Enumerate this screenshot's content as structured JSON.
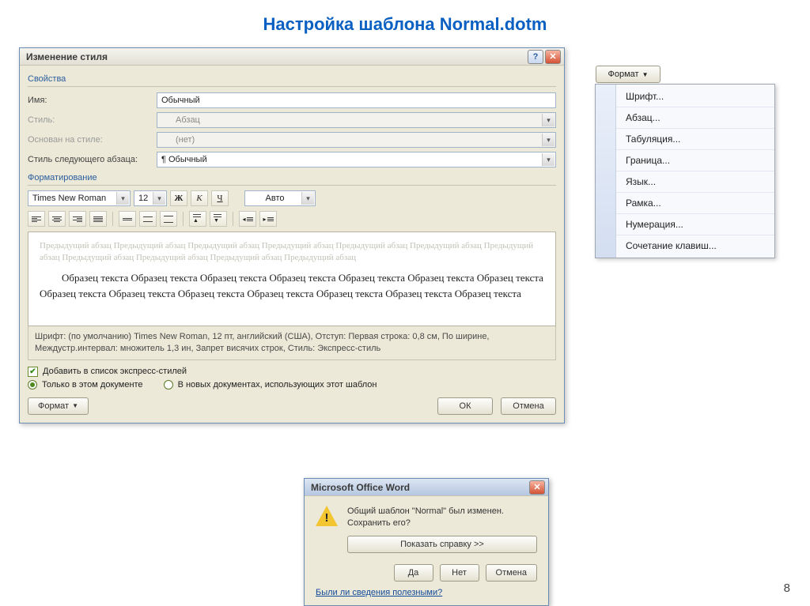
{
  "page": {
    "title": "Настройка шаблона Normal.dotm",
    "number": "8"
  },
  "dialog": {
    "title": "Изменение стиля",
    "section_props": "Свойства",
    "name_label": "Имя:",
    "name_value": "Обычный",
    "style_label": "Стиль:",
    "style_value": "Абзац",
    "basedon_label": "Основан на стиле:",
    "basedon_value": "(нет)",
    "next_label": "Стиль следующего абзаца:",
    "next_value": "¶ Обычный",
    "section_format": "Форматирование",
    "font_name": "Times New Roman",
    "font_size": "12",
    "bold": "Ж",
    "italic": "К",
    "underline": "Ч",
    "color_label": "Авто",
    "preview_ghost": "Предыдущий абзац Предыдущий абзац Предыдущий абзац Предыдущий абзац Предыдущий абзац Предыдущий абзац Предыдущий абзац Предыдущий абзац Предыдущий абзац Предыдущий абзац Предыдущий абзац",
    "preview_main": "Образец текста Образец текста Образец текста Образец текста Образец текста Образец текста Образец текста Образец текста Образец текста Образец текста Образец текста Образец текста Образец текста Образец текста",
    "description": "Шрифт: (по умолчанию) Times New Roman, 12 пт, английский (США), Отступ: Первая строка:  0,8 см, По ширине, Междустр.интервал: множитель 1,3 ин, Запрет висячих строк, Стиль: Экспресс-стиль",
    "check_quick": "Добавить в список экспресс-стилей",
    "radio_doc": "Только в этом документе",
    "radio_tpl": "В новых документах, использующих этот шаблон",
    "format_btn": "Формат",
    "ok": "ОК",
    "cancel": "Отмена"
  },
  "menu": {
    "button": "Формат",
    "items": [
      "Шрифт...",
      "Абзац...",
      "Табуляция...",
      "Граница...",
      "Язык...",
      "Рамка...",
      "Нумерация...",
      "Сочетание клавиш..."
    ]
  },
  "msg": {
    "title": "Microsoft Office Word",
    "text": "Общий шаблон \"Normal\" был изменен.  Сохранить его?",
    "help_btn": "Показать справку >>",
    "yes": "Да",
    "no": "Нет",
    "cancel": "Отмена",
    "link": "Были ли сведения полезными?"
  }
}
